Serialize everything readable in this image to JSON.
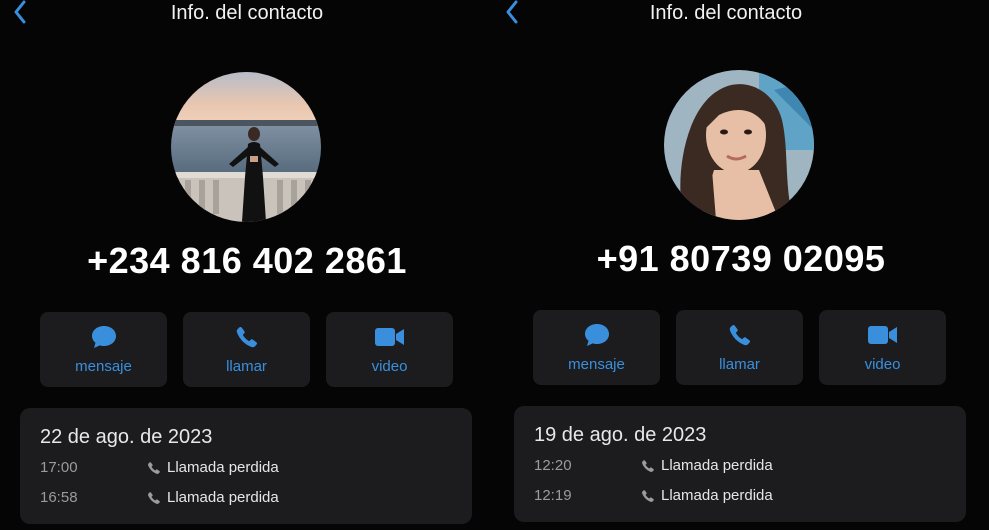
{
  "colors": {
    "background": "#050506",
    "card": "#1c1c1f",
    "accent": "#3a8fdd"
  },
  "panels": [
    {
      "header": {
        "back_icon": "chevron-left-icon",
        "title": "Info. del contacto"
      },
      "phone": "+234 816 402 2861",
      "actions": [
        {
          "label": "mensaje",
          "icon": "message-bubble-icon"
        },
        {
          "label": "llamar",
          "icon": "phone-icon"
        },
        {
          "label": "video",
          "icon": "video-camera-icon"
        }
      ],
      "calls": {
        "date": "22 de ago. de 2023",
        "entries": [
          {
            "time": "17:00",
            "status": "Llamada perdida"
          },
          {
            "time": "16:58",
            "status": "Llamada perdida"
          }
        ]
      }
    },
    {
      "header": {
        "back_icon": "chevron-left-icon",
        "title": "Info. del contacto"
      },
      "phone": "+91 80739 02095",
      "actions": [
        {
          "label": "mensaje",
          "icon": "message-bubble-icon"
        },
        {
          "label": "llamar",
          "icon": "phone-icon"
        },
        {
          "label": "video",
          "icon": "video-camera-icon"
        }
      ],
      "calls": {
        "date": "19 de ago. de 2023",
        "entries": [
          {
            "time": "12:20",
            "status": "Llamada perdida"
          },
          {
            "time": "12:19",
            "status": "Llamada perdida"
          }
        ]
      }
    }
  ]
}
